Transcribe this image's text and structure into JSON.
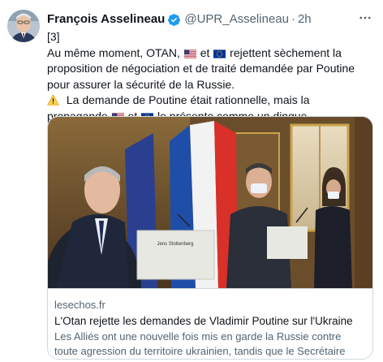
{
  "tweet": {
    "author_name": "François Asselineau",
    "handle": "@UPR_Asselineau",
    "separator": "·",
    "time": "2h",
    "thread_marker": "[3]",
    "para1_a": "Au même moment, OTAN,",
    "para1_b": "et",
    "para1_c": "rejettent sèchement la proposition de négociation et de traité demandée par Poutine pour assurer la sécurité de la Russie.",
    "para2_a": "La demande de Poutine était rationnelle, mais la propagande",
    "para2_b": "et",
    "para2_c": "le présente comme un dingue."
  },
  "card": {
    "domain": "lesechos.fr",
    "title": "L'Otan rejette les demandes de Vladimir Poutine sur l'Ukraine",
    "description": "Les Alliés ont une nouvelle fois mis en garde la Russie contre toute agression du territoire ukrainien, tandis que le Secrétaire général de ...",
    "podium_label": "Jens Stoltenberg"
  },
  "colors": {
    "verified": "#1d9bf0",
    "secondary_text": "#536471",
    "border": "#cfd9de"
  },
  "icons": [
    "verified-badge-icon",
    "more-options-icon",
    "us-flag-icon",
    "eu-flag-icon",
    "warning-icon"
  ]
}
